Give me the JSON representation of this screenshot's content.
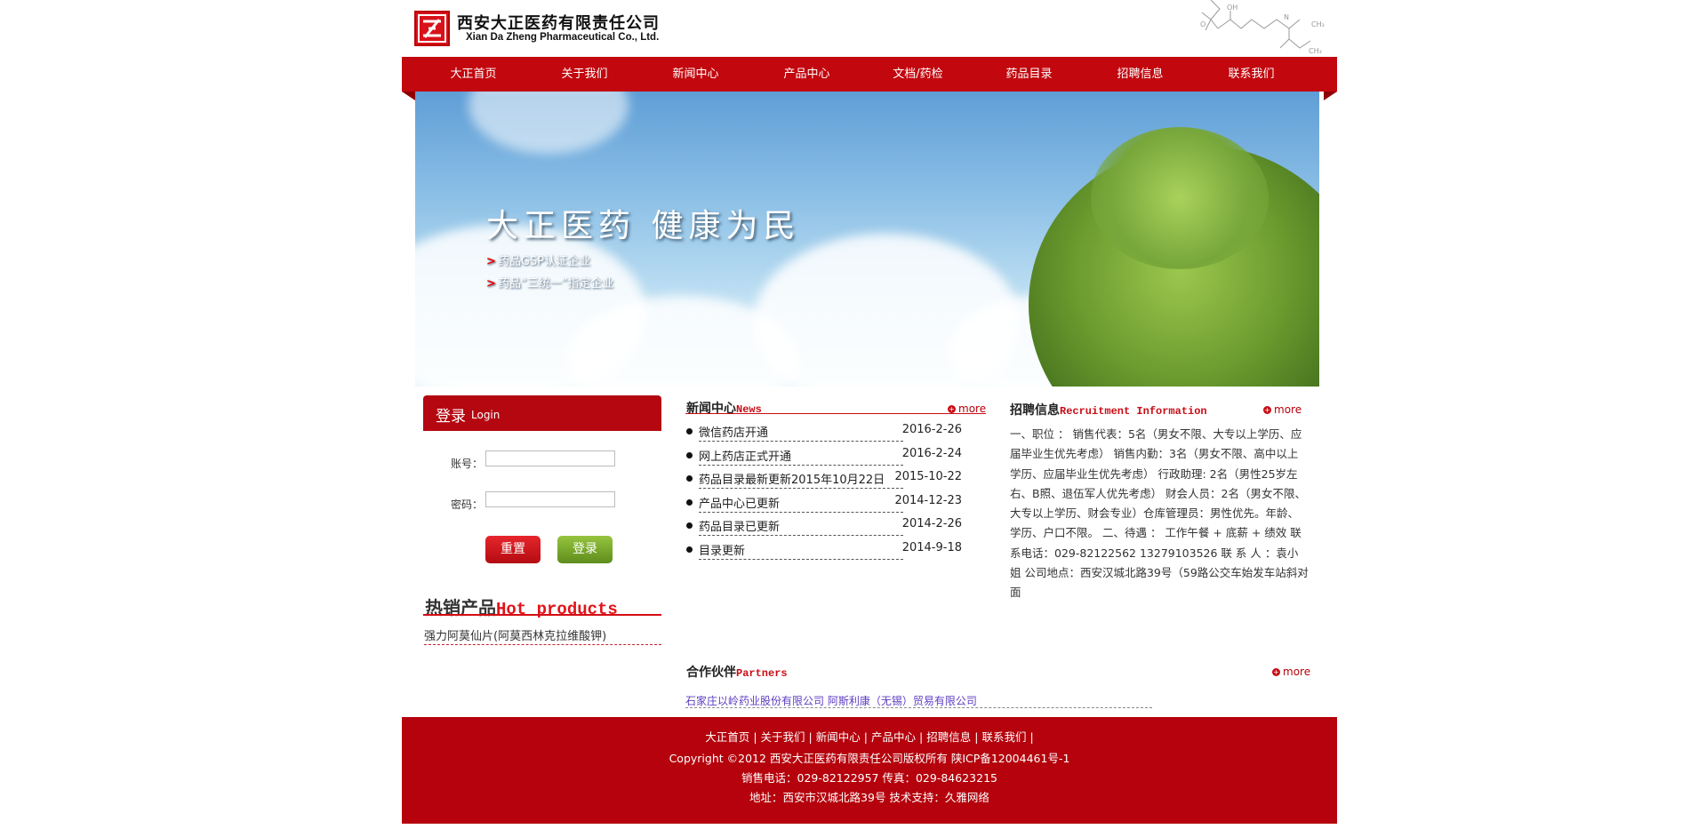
{
  "brand": {
    "name_cn": "西安大正医药有限责任公司",
    "name_en": "Xian Da Zheng Pharmaceutical Co., Ltd."
  },
  "nav": [
    "大正首页",
    "关于我们",
    "新闻中心",
    "产品中心",
    "文档/药检",
    "药品目录",
    "招聘信息",
    "联系我们"
  ],
  "banner": {
    "slogan": "大正医药  健康为民",
    "line1": "药品GSP认证企业",
    "line2": "药品“三统一”指定企业"
  },
  "login": {
    "title_cn": "登录",
    "title_en": "Login",
    "account_label": "账号：",
    "password_label": "密码：",
    "reset_label": "重置",
    "login_label": "登录"
  },
  "hot": {
    "title_cn": "热销产品",
    "title_en": "Hot products",
    "items": [
      "强力阿莫仙片(阿莫西林克拉维酸钾)"
    ]
  },
  "news": {
    "title_cn": "新闻中心",
    "title_en": "News",
    "more": "more",
    "items": [
      {
        "title": "微信药店开通",
        "date": "2016-2-26"
      },
      {
        "title": "网上药店正式开通",
        "date": "2016-2-24"
      },
      {
        "title": "药品目录最新更新2015年10月22日",
        "date": "2015-10-22"
      },
      {
        "title": "产品中心已更新",
        "date": "2014-12-23"
      },
      {
        "title": "药品目录已更新",
        "date": "2014-2-26"
      },
      {
        "title": "目录更新",
        "date": "2014-9-18"
      }
    ]
  },
  "recruit": {
    "title_cn": "招聘信息",
    "title_en": "Recruitment Information",
    "more": "more",
    "text": "一、职位 ： 销售代表：5名（男女不限、大专以上学历、应届毕业生优先考虑） 销售内勤：3名（男女不限、高中以上学历、应届毕业生优先考虑） 行政助理: 2名（男性25岁左右、B照、退伍军人优先考虑） 财会人员：2名（男女不限、大专以上学历、财会专业）仓库管理员：男性优先。年龄、学历、户口不限。 二、待遇 ： 工作午餐 + 底薪 + 绩效 联系电话：029-82122562 13279103526 联 系 人 ：袁小姐 公司地点：西安汉城北路39号（59路公交车始发车站斜对面"
  },
  "partners": {
    "title_cn": "合作伙伴",
    "title_en": "Partners",
    "more": "more",
    "text": "石家庄以岭药业股份有限公司 阿斯利康（无锡）贸易有限公司"
  },
  "footer": {
    "nav": [
      "大正首页",
      "关于我们",
      "新闻中心",
      "产品中心",
      "招聘信息",
      "联系我们"
    ],
    "copyright": "Copyright ©2012 西安大正医药有限责任公司版权所有 陕ICP备12004461号-1",
    "phone": "销售电话：029-82122957 传真：029-84623215",
    "address": "地址：西安市汉城北路39号   技术支持：久雅网络"
  },
  "colors": {
    "brand_red": "#c2070e",
    "footer_red": "#b5020c",
    "accent_green": "#7aa52b"
  }
}
